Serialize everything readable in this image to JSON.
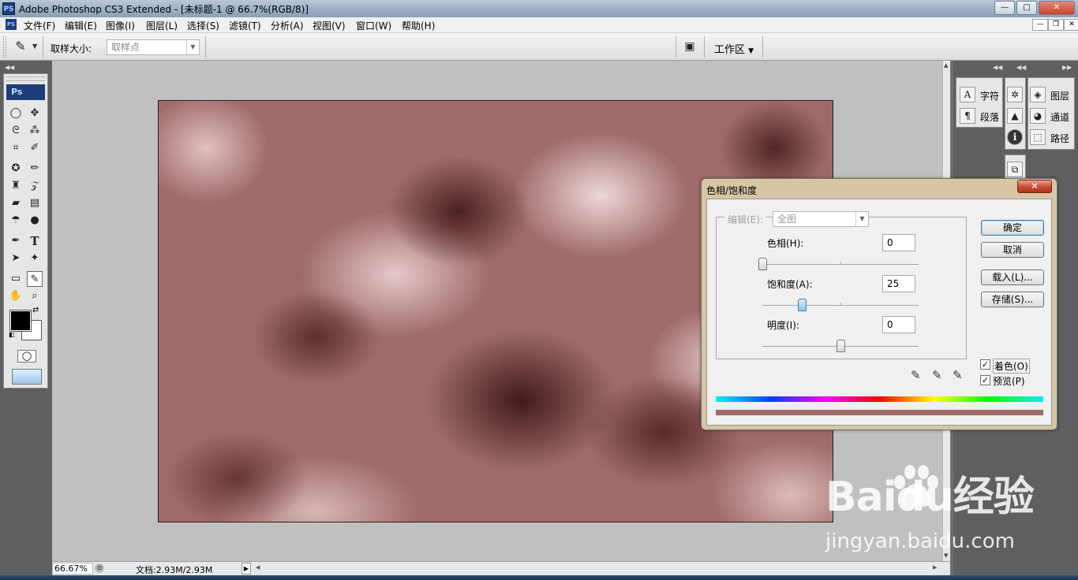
{
  "window": {
    "title": "Adobe Photoshop CS3 Extended - [未标题-1 @ 66.7%(RGB/8)]",
    "app_icon": "PS",
    "buttons": [
      "minimize",
      "maximize",
      "close"
    ]
  },
  "menubar": {
    "items": [
      "文件(F)",
      "编辑(E)",
      "图像(I)",
      "图层(L)",
      "选择(S)",
      "滤镜(T)",
      "分析(A)",
      "视图(V)",
      "窗口(W)",
      "帮助(H)"
    ],
    "doc_icon": "PS"
  },
  "options": {
    "sample_size_label": "取样大小:",
    "sample_size_value": "取样点",
    "workspace_label": "工作区"
  },
  "toolbox": {
    "logo": "Ps"
  },
  "right_panels": {
    "text_panel": [
      "字符",
      "段落"
    ],
    "layers_panel": [
      "图层",
      "通道",
      "路径"
    ]
  },
  "statusbar": {
    "zoom": "66.67%",
    "doc": "文档:2.93M/2.93M"
  },
  "dialog": {
    "title": "色相/饱和度",
    "edit_label": "编辑(E):",
    "edit_value": "全图",
    "hue": {
      "label": "色相(H):",
      "value": "0"
    },
    "saturation": {
      "label": "饱和度(A):",
      "value": "25"
    },
    "lightness": {
      "label": "明度(I):",
      "value": "0"
    },
    "buttons": {
      "ok": "确定",
      "cancel": "取消",
      "load": "载入(L)...",
      "save": "存储(S)..."
    },
    "colorize": {
      "label": "着色(O)",
      "checked": true
    },
    "preview": {
      "label": "预览(P)",
      "checked": true
    }
  },
  "watermark": {
    "brand": "Baidu经验",
    "url": "jingyan.baidu.com"
  },
  "colors": {
    "canvas_tint": "#a06a6a",
    "dialog_frame": "#d6c6a4",
    "close_red": "#c54a33"
  }
}
